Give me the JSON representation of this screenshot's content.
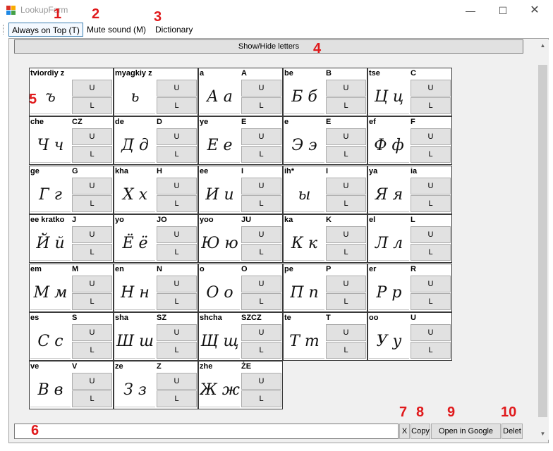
{
  "window": {
    "title": "LookupForm"
  },
  "toolbar": {
    "always_on_top": "Always on Top (T)",
    "mute_sound": "Mute sound (M)",
    "dictionary": "Dictionary"
  },
  "markers": [
    "1",
    "2",
    "3",
    "4",
    "5",
    "6",
    "7",
    "8",
    "9",
    "10"
  ],
  "show_hide_label": "Show/Hide letters",
  "buttons": {
    "upper": "U",
    "lower": "L"
  },
  "letters": [
    {
      "name": "tviordiy z",
      "lat": "",
      "script": "ъ"
    },
    {
      "name": "myagkiy z",
      "lat": "",
      "script": "ь"
    },
    {
      "name": "a",
      "lat": "A",
      "script": "А а"
    },
    {
      "name": "be",
      "lat": "B",
      "script": "Б б"
    },
    {
      "name": "tse",
      "lat": "C",
      "script": "Ц ц"
    },
    {
      "name": "che",
      "lat": "CZ",
      "script": "Ч ч"
    },
    {
      "name": "de",
      "lat": "D",
      "script": "Д д"
    },
    {
      "name": "ye",
      "lat": "E",
      "script": "Е е"
    },
    {
      "name": "e",
      "lat": "E",
      "script": "Э э"
    },
    {
      "name": "ef",
      "lat": "F",
      "script": "Ф ф"
    },
    {
      "name": "ge",
      "lat": "G",
      "script": "Г г"
    },
    {
      "name": "kha",
      "lat": "H",
      "script": "Х х"
    },
    {
      "name": "ee",
      "lat": "I",
      "script": "И и"
    },
    {
      "name": "ih*",
      "lat": "I",
      "script": "ы"
    },
    {
      "name": "ya",
      "lat": "ia",
      "script": "Я я"
    },
    {
      "name": "ee kratko",
      "lat": "J",
      "script": "Й й"
    },
    {
      "name": "yo",
      "lat": "JO",
      "script": "Ё ё"
    },
    {
      "name": "yoo",
      "lat": "JU",
      "script": "Ю ю"
    },
    {
      "name": "ka",
      "lat": "K",
      "script": "К к"
    },
    {
      "name": "el",
      "lat": "L",
      "script": "Л л"
    },
    {
      "name": "em",
      "lat": "M",
      "script": "М м"
    },
    {
      "name": "en",
      "lat": "N",
      "script": "Н н"
    },
    {
      "name": "o",
      "lat": "O",
      "script": "О о"
    },
    {
      "name": "pe",
      "lat": "P",
      "script": "П п"
    },
    {
      "name": "er",
      "lat": "R",
      "script": "Р р"
    },
    {
      "name": "es",
      "lat": "S",
      "script": "С с"
    },
    {
      "name": "sha",
      "lat": "SZ",
      "script": "Ш ш"
    },
    {
      "name": "shcha",
      "lat": "SZCZ",
      "script": "Щ щ"
    },
    {
      "name": "te",
      "lat": "T",
      "script": "Т т"
    },
    {
      "name": "oo",
      "lat": "U",
      "script": "У у"
    },
    {
      "name": "ve",
      "lat": "V",
      "script": "В в"
    },
    {
      "name": "ze",
      "lat": "Z",
      "script": "З з"
    },
    {
      "name": "zhe",
      "lat": "ŻE",
      "script": "Ж ж"
    }
  ],
  "bottom": {
    "clear": "X",
    "copy": "Copy",
    "google": "Open in Google",
    "delete": "Delet"
  },
  "colors": {
    "marker": "#e0191b",
    "focus_border": "#3c7fb1"
  }
}
